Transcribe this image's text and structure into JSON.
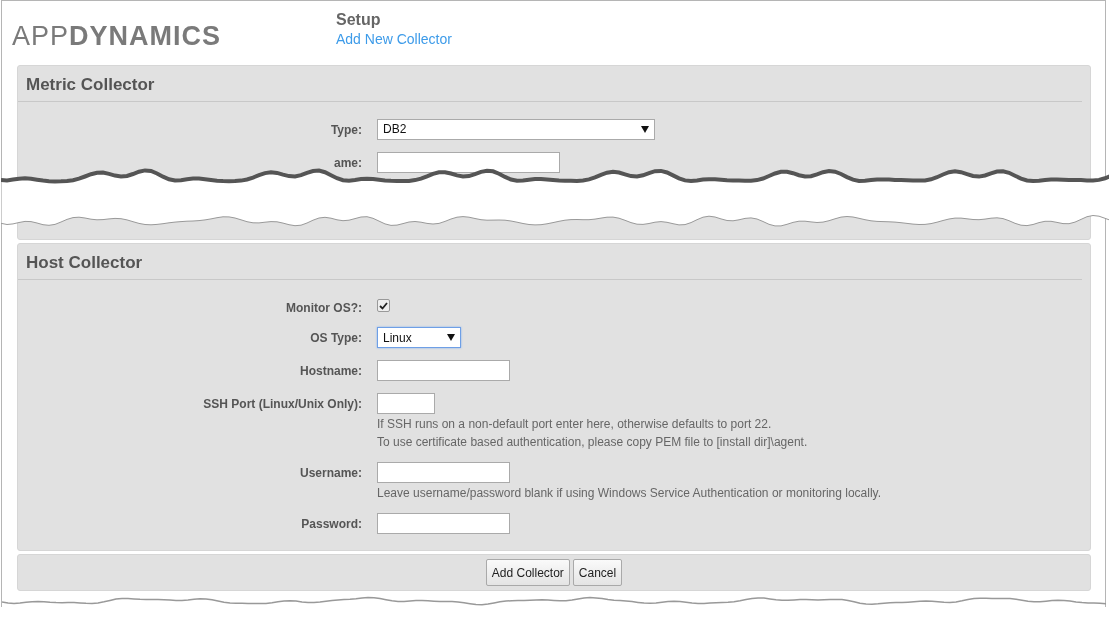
{
  "logo": "APP**DYNAMICS**",
  "header": {
    "title": "Setup",
    "link": "Add New Collector"
  },
  "metric_collector": {
    "title": "Metric Collector",
    "fields": [
      {
        "kind": "select",
        "label": "Type:",
        "value": "DB2",
        "focused": false
      },
      {
        "kind": "text",
        "label": "ame:"
      }
    ]
  },
  "host_collector": {
    "title": "Host Collector",
    "fields": [
      {
        "kind": "checkbox",
        "label": "Monitor OS?:",
        "checked": true
      },
      {
        "kind": "select",
        "label": "OS Type:",
        "value": "Linux",
        "focused": true
      },
      {
        "kind": "text",
        "label": "Hostname:"
      },
      {
        "kind": "port",
        "label": "SSH Port (Linux/Unix Only):",
        "hints": [
          "If SSH runs on a non-default port enter here, otherwise defaults to port 22.",
          "To use certificate based authentication, please copy PEM file to [install dir]\\agent."
        ]
      },
      {
        "kind": "text",
        "label": "Username:",
        "hints": [
          "Leave username/password blank if using Windows Service Authentication or monitoring locally."
        ]
      },
      {
        "kind": "password",
        "label": "Password:"
      }
    ]
  },
  "buttons": [
    "Add Collector",
    "Cancel"
  ]
}
